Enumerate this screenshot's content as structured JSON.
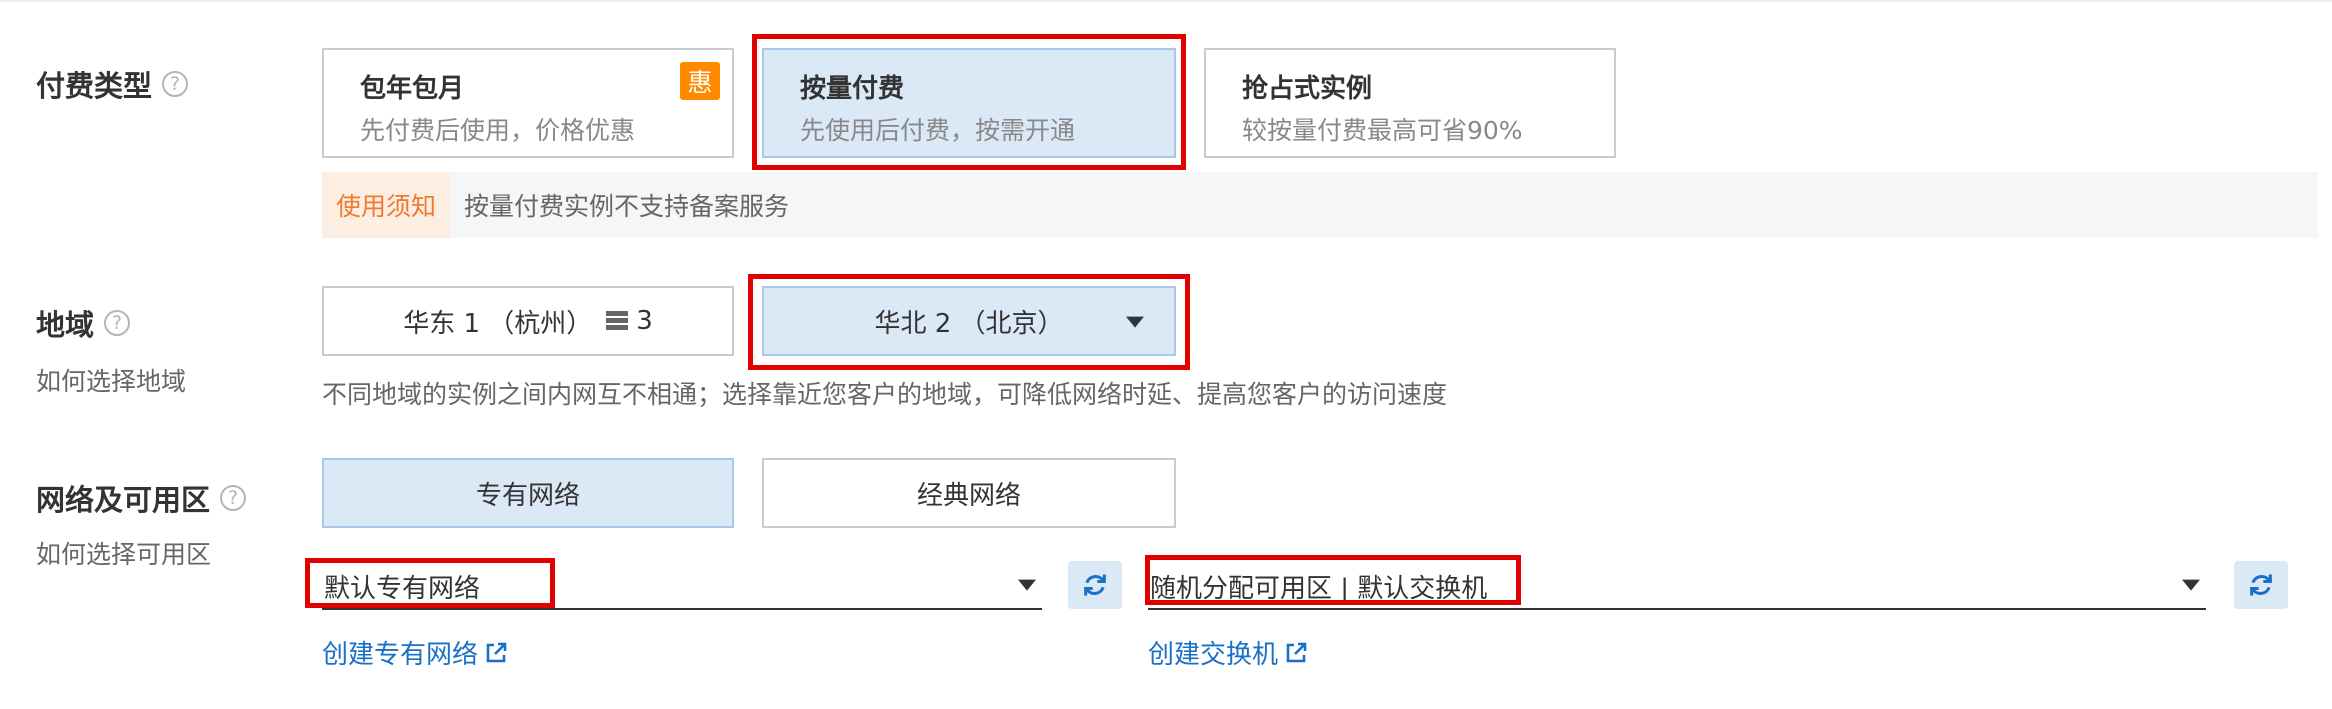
{
  "billing": {
    "label": "付费类型",
    "options": [
      {
        "title": "包年包月",
        "desc": "先付费后使用，价格优惠",
        "badge": "惠"
      },
      {
        "title": "按量付费",
        "desc": "先使用后付费，按需开通"
      },
      {
        "title": "抢占式实例",
        "desc": "较按量付费最高可省90%"
      }
    ],
    "notice_tag": "使用须知",
    "notice_text": "按量付费实例不支持备案服务"
  },
  "region": {
    "label": "地域",
    "sub_label": "如何选择地域",
    "options": [
      {
        "label": "华东 1 （杭州）",
        "count": "3"
      },
      {
        "label": "华北 2 （北京）"
      }
    ],
    "hint": "不同地域的实例之间内网互不相通；选择靠近您客户的地域，可降低网络时延、提高您客户的访问速度"
  },
  "network": {
    "label": "网络及可用区",
    "sub_label": "如何选择可用区",
    "types": [
      "专有网络",
      "经典网络"
    ],
    "vpc_value": "默认专有网络",
    "zone_value": "随机分配可用区 | 默认交换机",
    "create_vpc_link": "创建专有网络",
    "create_switch_link": "创建交换机"
  },
  "colors": {
    "highlight": "#e00000",
    "selected_bg": "#dbe8f6",
    "link": "#1a6fc7",
    "badge": "#ff8a00"
  }
}
